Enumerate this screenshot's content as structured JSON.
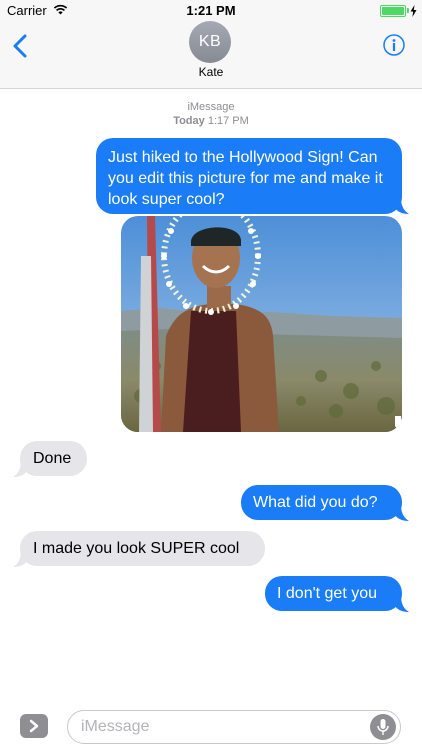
{
  "status_bar": {
    "carrier": "Carrier",
    "time": "1:21 PM",
    "wifi_icon": "wifi-icon",
    "battery_icon": "battery-icon",
    "charging_icon": "charging-bolt-icon"
  },
  "header": {
    "avatar_initials": "KB",
    "contact_name": "Kate",
    "back_icon": "chevron-left-icon",
    "info_icon": "info-circle-icon",
    "accent_color": "#1a7cf6"
  },
  "meta": {
    "service": "iMessage",
    "day": "Today",
    "time": "1:17 PM"
  },
  "messages": [
    {
      "direction": "outgoing",
      "text": "Just hiked to the Hollywood Sign! Can you edit this picture for me and make it look super cool?"
    },
    {
      "direction": "outgoing",
      "type": "image",
      "alt": "photo of a man with flower wreath around face"
    },
    {
      "direction": "incoming",
      "text": "Done"
    },
    {
      "direction": "outgoing",
      "text": "What did you do?"
    },
    {
      "direction": "incoming",
      "text": "I made you look SUPER cool"
    },
    {
      "direction": "outgoing",
      "text": "I don't get you"
    }
  ],
  "input_bar": {
    "placeholder": "iMessage",
    "apps_icon": "chevron-right-icon",
    "mic_icon": "microphone-icon"
  },
  "colors": {
    "outgoing_bubble": "#1a7cf6",
    "incoming_bubble": "#e5e5ea",
    "battery": "#4cd964"
  }
}
